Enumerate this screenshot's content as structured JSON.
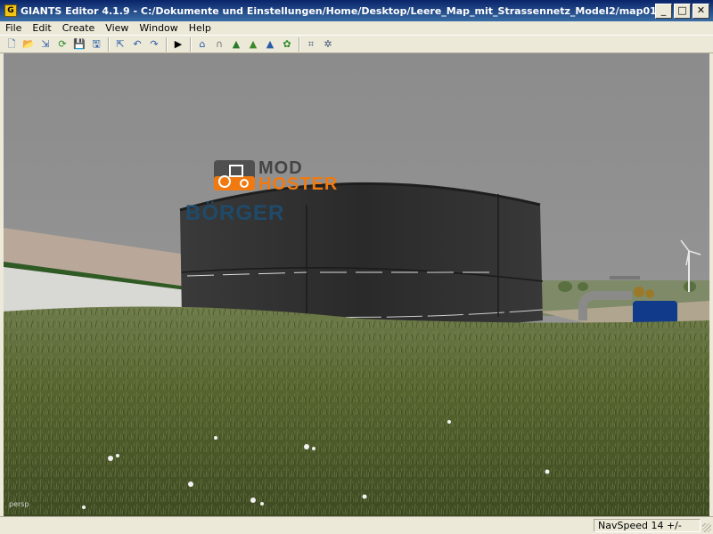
{
  "window": {
    "title": "GIANTS Editor 4.1.9 - C:/Dokumente und Einstellungen/Home/Desktop/Leere_Map_mit_Strassennetz_Model2/map01.i3d",
    "app_icon_glyph": "G",
    "minimize_glyph": "_",
    "maximize_glyph": "□",
    "close_glyph": "✕"
  },
  "menu": [
    "File",
    "Edit",
    "Create",
    "View",
    "Window",
    "Help"
  ],
  "toolbar": {
    "groups": [
      [
        {
          "name": "new-icon",
          "glyph": "🗋",
          "color": "#2a5caa"
        },
        {
          "name": "open-icon",
          "glyph": "📂",
          "color": "#c08a20"
        },
        {
          "name": "import-icon",
          "glyph": "⇲",
          "color": "#2a5caa"
        },
        {
          "name": "reload-icon",
          "glyph": "⟳",
          "color": "#2a8a2a"
        },
        {
          "name": "save-icon",
          "glyph": "💾",
          "color": "#2a5caa"
        },
        {
          "name": "save-as-icon",
          "glyph": "🖫",
          "color": "#2a5caa"
        }
      ],
      [
        {
          "name": "export-icon",
          "glyph": "⇱",
          "color": "#2a5caa"
        },
        {
          "name": "undo-icon",
          "glyph": "↶",
          "color": "#2a5caa"
        },
        {
          "name": "redo-icon",
          "glyph": "↷",
          "color": "#2a5caa"
        }
      ],
      [
        {
          "name": "play-icon",
          "glyph": "▶",
          "color": "#000000"
        }
      ],
      [
        {
          "name": "home-icon",
          "glyph": "⌂",
          "color": "#2a5caa"
        },
        {
          "name": "select-icon",
          "glyph": "∩",
          "color": "#777777"
        },
        {
          "name": "terrain-sculpt-icon",
          "glyph": "▲",
          "color": "#2a7a2a"
        },
        {
          "name": "terrain-paint-icon",
          "glyph": "▲",
          "color": "#3a8a2a"
        },
        {
          "name": "foliage-paint-icon",
          "glyph": "▲",
          "color": "#2a5caa"
        },
        {
          "name": "plant-icon",
          "glyph": "✿",
          "color": "#2a8a2a"
        }
      ],
      [
        {
          "name": "grid-icon",
          "glyph": "⌗",
          "color": "#445577"
        },
        {
          "name": "settings-icon",
          "glyph": "✲",
          "color": "#445577"
        }
      ]
    ]
  },
  "viewport": {
    "camera_mode": "persp",
    "tank_brand": "BÖRGER",
    "watermark": {
      "line1": "MOD",
      "line2": "HOSTER"
    }
  },
  "statusbar": {
    "nav_speed": "NavSpeed 14 +/-"
  },
  "colors": {
    "sky": "#8a8a8a",
    "grass": "#5a6a36",
    "tank": "#2b2b2b",
    "watermark_orange": "#f07a10"
  }
}
